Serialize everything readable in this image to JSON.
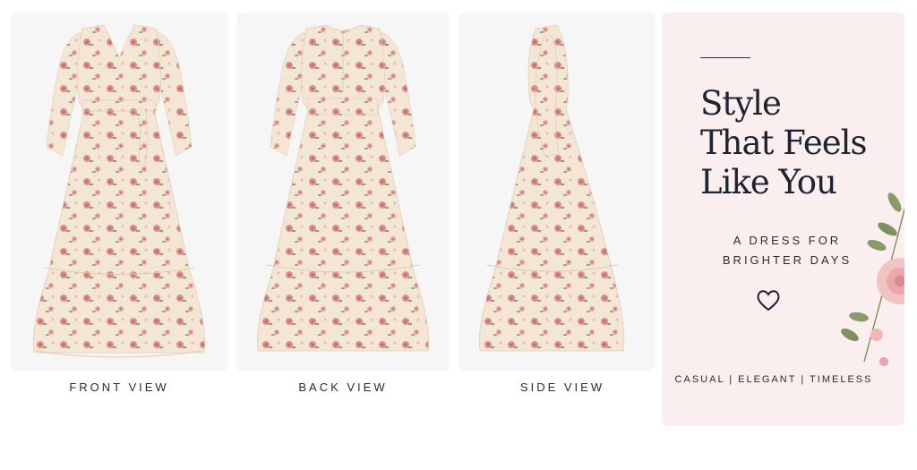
{
  "views": [
    {
      "label": "FRONT VIEW"
    },
    {
      "label": "BACK VIEW"
    },
    {
      "label": "SIDE VIEW"
    }
  ],
  "promo": {
    "headline": [
      "Style",
      "That Feels",
      "Like You"
    ],
    "subline": [
      "A DRESS FOR",
      "BRIGHTER DAYS"
    ],
    "tags": "CASUAL  |  ELEGANT  |  TIMELESS"
  },
  "colors": {
    "fabric": "#f4e6d4",
    "rose": "#d98a8a",
    "leaf": "#8a9a6a",
    "panel": "#f6f6f6",
    "promo_bg": "#fbeeee",
    "ink": "#1d2431"
  },
  "icons": [
    "heart-outline-icon",
    "rose-branch-decoration"
  ]
}
